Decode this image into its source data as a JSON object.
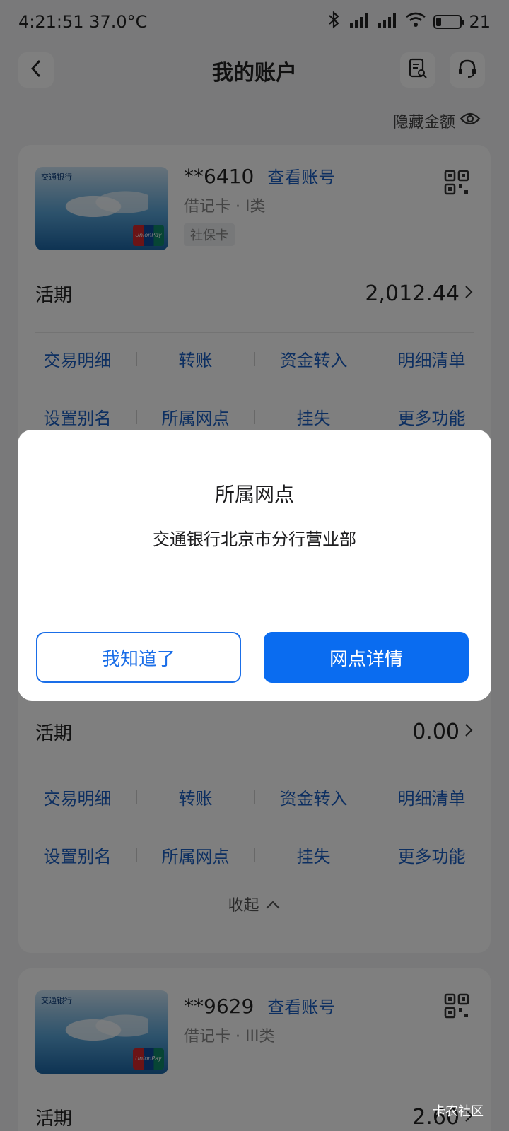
{
  "status": {
    "time": "4:21:51",
    "temperature": "37.0°C",
    "battery": "21"
  },
  "header": {
    "title": "我的账户"
  },
  "hide_amount_label": "隐藏金额",
  "accounts": [
    {
      "number": "**6410",
      "view_account": "查看账号",
      "type": "借记卡 · I类",
      "tag": "社保卡",
      "balance_label": "活期",
      "balance": "2,012.44",
      "actions_row1": [
        "交易明细",
        "转账",
        "资金转入",
        "明细清单"
      ],
      "actions_row2": [
        "设置别名",
        "所属网点",
        "挂失",
        "更多功能"
      ]
    },
    {
      "balance_label": "活期",
      "balance": "0.00",
      "actions_row1": [
        "交易明细",
        "转账",
        "资金转入",
        "明细清单"
      ],
      "actions_row2": [
        "设置别名",
        "所属网点",
        "挂失",
        "更多功能"
      ],
      "collapse": "收起"
    },
    {
      "number": "**9629",
      "view_account": "查看账号",
      "type": "借记卡 · III类",
      "balance_label": "活期",
      "balance": "2.60"
    }
  ],
  "card_brand": {
    "bank_logo": "交通银行",
    "network": "UnionPay 银联"
  },
  "modal": {
    "title": "所属网点",
    "message": "交通银行北京市分行营业部",
    "secondary_button": "我知道了",
    "primary_button": "网点详情"
  },
  "watermark": "卡农社区"
}
